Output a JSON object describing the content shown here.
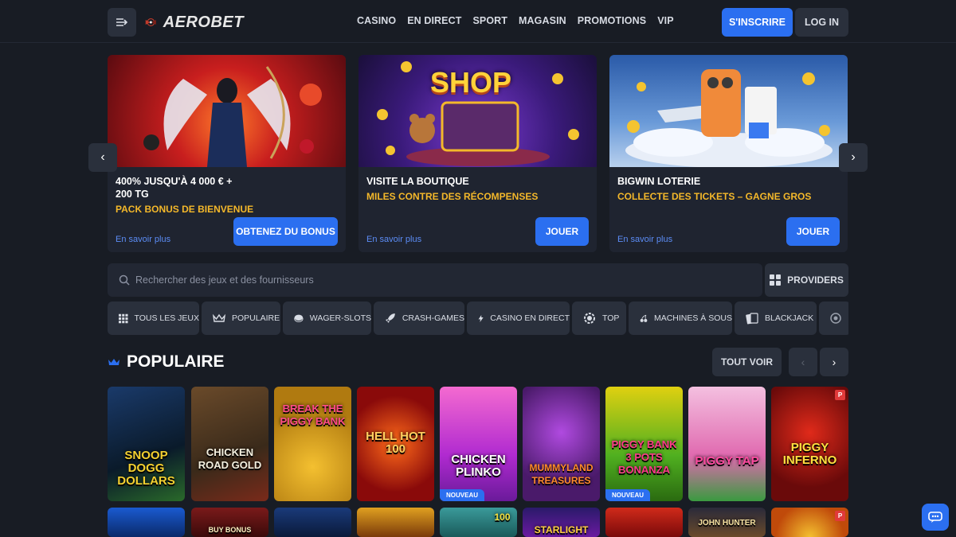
{
  "header": {
    "logo": "AEROBET",
    "nav": [
      "CASINO",
      "EN DIRECT",
      "SPORT",
      "MAGASIN",
      "PROMOTIONS",
      "VIP"
    ],
    "signup_label": "S'INSCRIRE",
    "login_label": "LOG IN"
  },
  "promos": [
    {
      "title": "400% JUSQU'À 4 000 € + 200 TG",
      "subtitle": "PACK BONUS DE BIENVENUE",
      "more": "En savoir plus",
      "cta": "OBTENEZ DU BONUS"
    },
    {
      "title": "VISITE LA BOUTIQUE",
      "subtitle": "MILES CONTRE DES RÉCOMPENSES",
      "more": "En savoir plus",
      "cta": "JOUER",
      "banner_text": "SHOP"
    },
    {
      "title": "BIGWIN LOTERIE",
      "subtitle": "COLLECTE DES TICKETS – GAGNE GROS",
      "more": "En savoir plus",
      "cta": "JOUER"
    }
  ],
  "search": {
    "placeholder": "Rechercher des jeux et des fournisseurs",
    "providers_label": "PROVIDERS"
  },
  "categories": [
    "TOUS LES JEUX",
    "POPULAIRE",
    "WAGER-SLOTS",
    "CRASH-GAMES",
    "CASINO EN DIRECT",
    "TOP",
    "MACHINES À SOUS",
    "BLACKJACK"
  ],
  "section": {
    "title": "POPULAIRE",
    "see_all": "TOUT VOIR"
  },
  "games": [
    {
      "name": "SNOOP DOGG DOLLARS"
    },
    {
      "name": "CHICKEN ROAD GOLD"
    },
    {
      "name": "BREAK THE PIGGY BANK"
    },
    {
      "name": "HELL HOT 100"
    },
    {
      "name": "CHICKEN PLINKO",
      "badge": "NOUVEAU"
    },
    {
      "name": "MUMMYLAND TREASURES"
    },
    {
      "name": "PIGGY BANK 3 POTS BONANZA",
      "badge": "NOUVEAU"
    },
    {
      "name": "PIGGY TAP"
    },
    {
      "name": "PIGGY INFERNO",
      "pbadge": "P"
    }
  ],
  "games_row2": [
    {
      "name": ""
    },
    {
      "name": "BUY BONUS"
    },
    {
      "name": ""
    },
    {
      "name": ""
    },
    {
      "name": "100"
    },
    {
      "name": "STARLIGHT"
    },
    {
      "name": ""
    },
    {
      "name": "JOHN HUNTER"
    },
    {
      "name": "",
      "pbadge": "P"
    }
  ],
  "colors": {
    "accent": "#2b6ff0",
    "gold": "#f4b82a",
    "bg": "#181c24",
    "card": "#2a303c"
  }
}
